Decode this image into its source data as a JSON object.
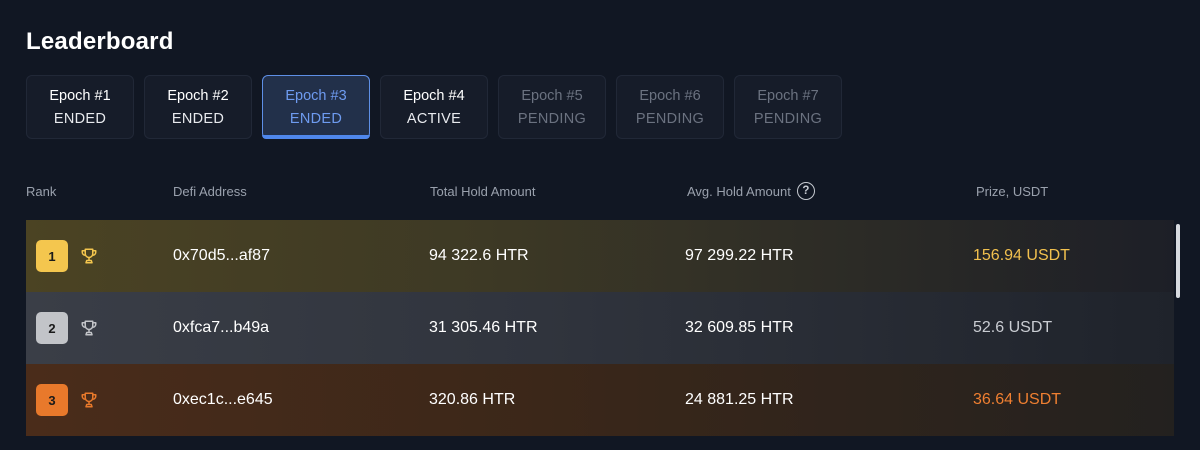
{
  "page": {
    "title": "Leaderboard"
  },
  "tabs": [
    {
      "name": "Epoch #1",
      "status": "ENDED"
    },
    {
      "name": "Epoch #2",
      "status": "ENDED"
    },
    {
      "name": "Epoch #3",
      "status": "ENDED",
      "selected": true
    },
    {
      "name": "Epoch #4",
      "status": "ACTIVE"
    },
    {
      "name": "Epoch #5",
      "status": "PENDING"
    },
    {
      "name": "Epoch #6",
      "status": "PENDING"
    },
    {
      "name": "Epoch #7",
      "status": "PENDING"
    }
  ],
  "table": {
    "headers": {
      "rank": "Rank",
      "address": "Defi Address",
      "total": "Total Hold Amount",
      "avg": "Avg. Hold Amount",
      "prize": "Prize, USDT"
    },
    "rows": [
      {
        "rank": "1",
        "address": "0x70d5...af87",
        "total": "94 322.6 HTR",
        "avg": "97 299.22 HTR",
        "prize": "156.94 USDT",
        "prize_color": "#f2c14e"
      },
      {
        "rank": "2",
        "address": "0xfca7...b49a",
        "total": "31 305.46 HTR",
        "avg": "32 609.85 HTR",
        "prize": "52.6 USDT",
        "prize_color": "#c9ccd2"
      },
      {
        "rank": "3",
        "address": "0xec1c...e645",
        "total": "320.86 HTR",
        "avg": "24 881.25 HTR",
        "prize": "36.64 USDT",
        "prize_color": "#ef7f31"
      }
    ]
  },
  "icons": {
    "help": "question-circle-icon",
    "trophy": "trophy-icon"
  },
  "colors": {
    "accent": "#4f87ec",
    "gold": "#f4c64e",
    "silver": "#c2c4c8",
    "bronze": "#e8792b",
    "background": "#111723"
  }
}
